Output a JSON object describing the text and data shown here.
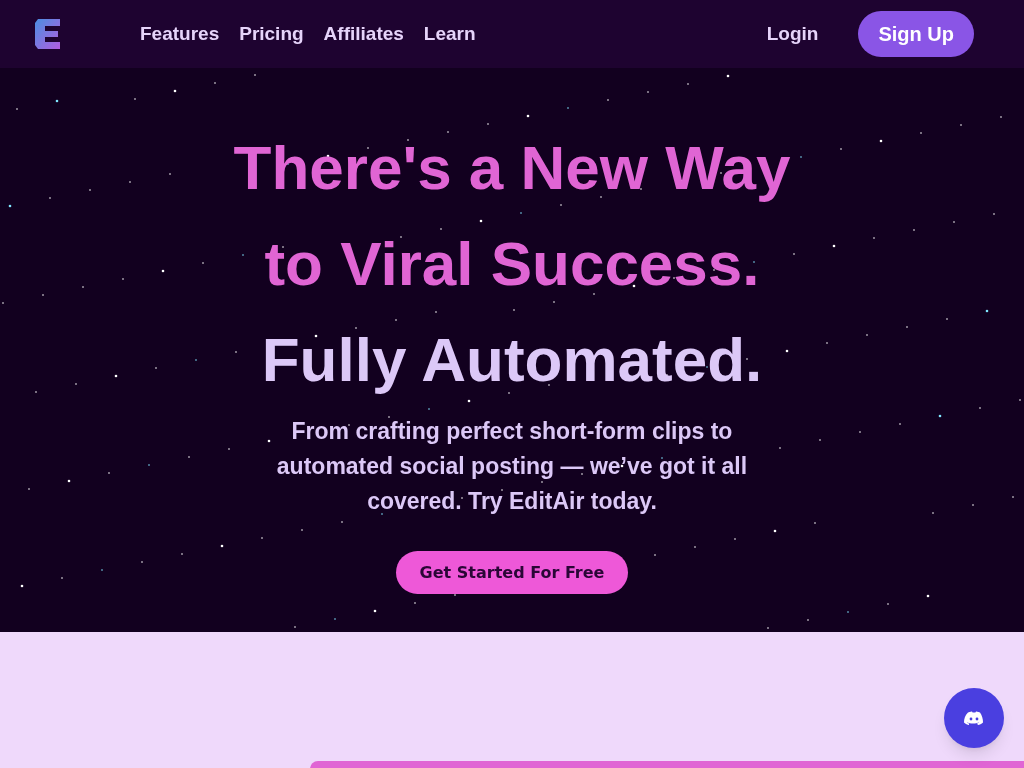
{
  "nav": {
    "links": [
      "Features",
      "Pricing",
      "Affiliates",
      "Learn"
    ],
    "login": "Login",
    "signup": "Sign Up"
  },
  "hero": {
    "headline": [
      {
        "text": "There's a New Way",
        "kind": "accent"
      },
      {
        "text": "to Viral Success.",
        "kind": "accent"
      },
      {
        "text": "Fully Automated.",
        "kind": "plain"
      }
    ],
    "subtitle": "From crafting perfect short-form clips to automated social posting — we’ve got it all covered. Try EditAir today.",
    "cta": "Get Started For Free"
  }
}
